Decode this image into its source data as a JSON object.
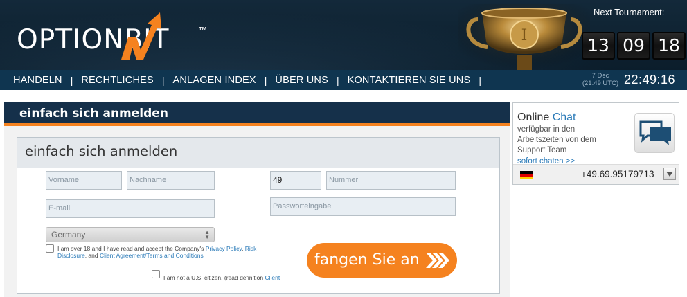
{
  "header": {
    "logo_text": "OPTIONBIT",
    "logo_tm": "™",
    "tournament_label": "Next Tournament:",
    "countdown": [
      "13",
      "09",
      "18"
    ]
  },
  "nav": {
    "items": [
      "HANDELN",
      "RECHTLICHES",
      "ANLAGEN INDEX",
      "ÜBER UNS",
      "KONTAKTIEREN SIE UNS"
    ],
    "separator": "|",
    "date": "7 Dec",
    "utc_time": "(21:49 UTC)",
    "time": "22:49:16"
  },
  "main": {
    "panel_title": "einfach sich anmelden",
    "form_title": "einfach sich anmelden",
    "fields": {
      "first_name_placeholder": "Vorname",
      "last_name_placeholder": "Nachname",
      "phone_prefix_value": "49",
      "phone_number_placeholder": "Nummer",
      "email_placeholder": "E-mail",
      "password_placeholder": "Passworteingabe"
    },
    "country_value": "Germany",
    "terms": {
      "line1_prefix": "I am over 18 and I have read and accept the Company's ",
      "privacy_link": "Privacy Policy",
      "comma": ", ",
      "risk_link": "Risk",
      "line2_risk_cont": "Disclosure",
      "and": ", and ",
      "client_link": "Client Agreement/Terms and Conditions"
    },
    "us_citizen": {
      "text": "I am not a U.S. citizen. (read definition ",
      "link": "Client"
    },
    "start_button": "fangen Sie an"
  },
  "chat": {
    "title_part1": "Online ",
    "title_part2": "Chat",
    "description": "verfügbar in den Arbeitszeiten von dem Support Team",
    "link": "sofort chaten >>",
    "phone": "+49.69.95179713",
    "flag_icon": "germany-flag-icon"
  },
  "colors": {
    "header_bg": "#0b1d2b",
    "nav_bg": "#0f3550",
    "accent_orange": "#f5821f",
    "panel_header": "#15304a",
    "link_blue": "#2a7ab8"
  }
}
